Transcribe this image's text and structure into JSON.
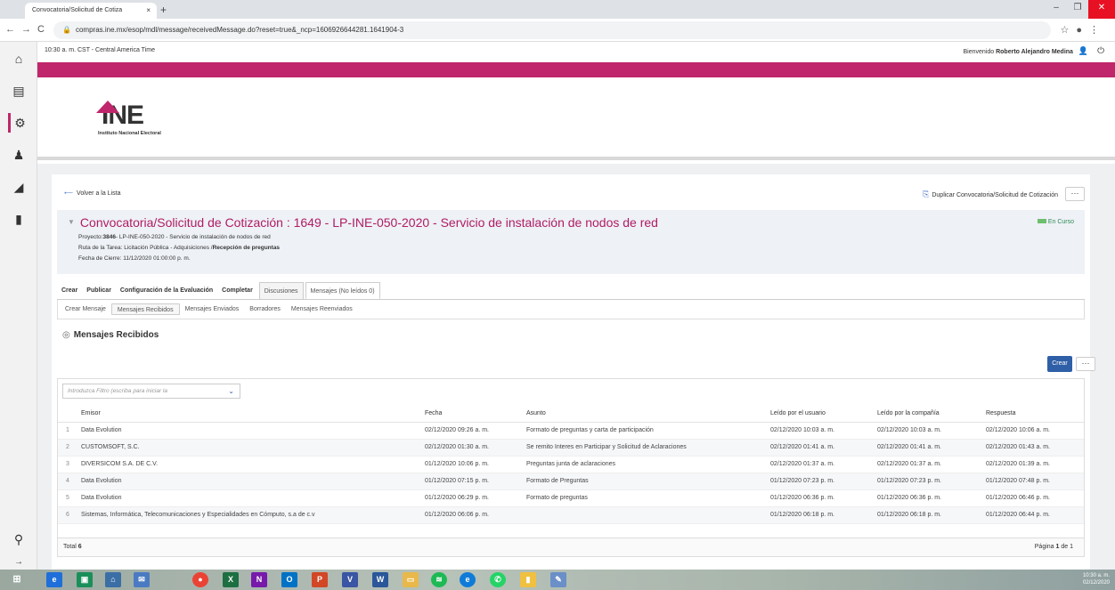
{
  "browser": {
    "tab_title": "Convocatoria/Solicitud de Cotiza",
    "tab_close": "×",
    "new_tab": "+",
    "url": "compras.ine.mx/esop/mdl/message/receivedMessage.do?reset=true&_ncp=1606926644281.1641904-3"
  },
  "topinfo": {
    "time": "10:30 a. m. CST - Central America Time",
    "welcome": "Bienvenido",
    "user": "Roberto Alejandro Medina"
  },
  "logo": {
    "name": "INE",
    "subtitle": "Instituto Nacional Electoral"
  },
  "toolbar": {
    "back": "Volver a la Lista",
    "duplicate": "Duplicar Convocatoria/Solicitud de Cotización",
    "more": "···"
  },
  "summary": {
    "title": "Convocatoria/Solicitud de Cotización : 1649 - LP-INE-050-2020 - Servicio de instalación de nodos de red",
    "project_label": "Proyecto:",
    "project_id": "3846",
    "project_rest": "- LP-INE-050-2020 - Servicio de instalación de nodos de red",
    "route_label": "Ruta de la Tarea: Licitación Pública - Adquisiciones /",
    "route_step": "Recepción de preguntas",
    "close_date": "Fecha de Cierre: 11/12/2020 01:00:00 p. m.",
    "status": "En Curso"
  },
  "tabs": [
    "Crear",
    "Publicar",
    "Configuración de la Evaluación",
    "Completar",
    "Discusiones",
    "Mensajes (No leídos 0)"
  ],
  "subtabs": [
    "Crear Mensaje",
    "Mensajes Recibidos",
    "Mensajes Enviados",
    "Borradores",
    "Mensajes Reenviados"
  ],
  "section_title": "Mensajes Recibidos",
  "create_button": "Crear",
  "filter_placeholder": "Introduzca Filtro (escriba para iniciar la",
  "table": {
    "headers": [
      "",
      "Emisor",
      "Fecha",
      "Asunto",
      "Leído por el usuario",
      "Leído por la compañía",
      "Respuesta"
    ],
    "rows": [
      [
        "1",
        "Data Evolution",
        "02/12/2020 09:26 a. m.",
        "Formato de preguntas y carta de participación",
        "02/12/2020 10:03 a. m.",
        "02/12/2020 10:03 a. m.",
        "02/12/2020 10:06 a. m."
      ],
      [
        "2",
        "CUSTOMSOFT, S.C.",
        "02/12/2020 01:30 a. m.",
        "Se remito Interes en Participar y Solicitud de Aclaraciones",
        "02/12/2020 01:41 a. m.",
        "02/12/2020 01:41 a. m.",
        "02/12/2020 01:43 a. m."
      ],
      [
        "3",
        "DIVERSICOM S.A. DE C.V.",
        "01/12/2020 10:06 p. m.",
        "Preguntas junta de aclaraciones",
        "02/12/2020 01:37 a. m.",
        "02/12/2020 01:37 a. m.",
        "02/12/2020 01:39 a. m."
      ],
      [
        "4",
        "Data Evolution",
        "01/12/2020 07:15 p. m.",
        "Formato de Preguntas",
        "01/12/2020 07:23 p. m.",
        "01/12/2020 07:23 p. m.",
        "01/12/2020 07:48 p. m."
      ],
      [
        "5",
        "Data Evolution",
        "01/12/2020 06:29 p. m.",
        "Formato de preguntas",
        "01/12/2020 06:36 p. m.",
        "01/12/2020 06:36 p. m.",
        "01/12/2020 06:46 p. m."
      ],
      [
        "6",
        "Sistemas, Informática, Telecomunicaciones y Especialidades en Cómputo, s.a de c.v",
        "01/12/2020 06:06 p. m.",
        "",
        "01/12/2020 06:18 p. m.",
        "01/12/2020 06:18 p. m.",
        "01/12/2020 06:44 p. m."
      ]
    ]
  },
  "footer": {
    "total_label": "Total",
    "total": "6",
    "page_label": "Página",
    "page": "1",
    "page_of": "de 1"
  },
  "clock": {
    "time": "10:30 a. m.",
    "date": "02/12/2020"
  },
  "colors": {
    "brand": "#c0266b",
    "primary_button": "#2f5fa7"
  }
}
